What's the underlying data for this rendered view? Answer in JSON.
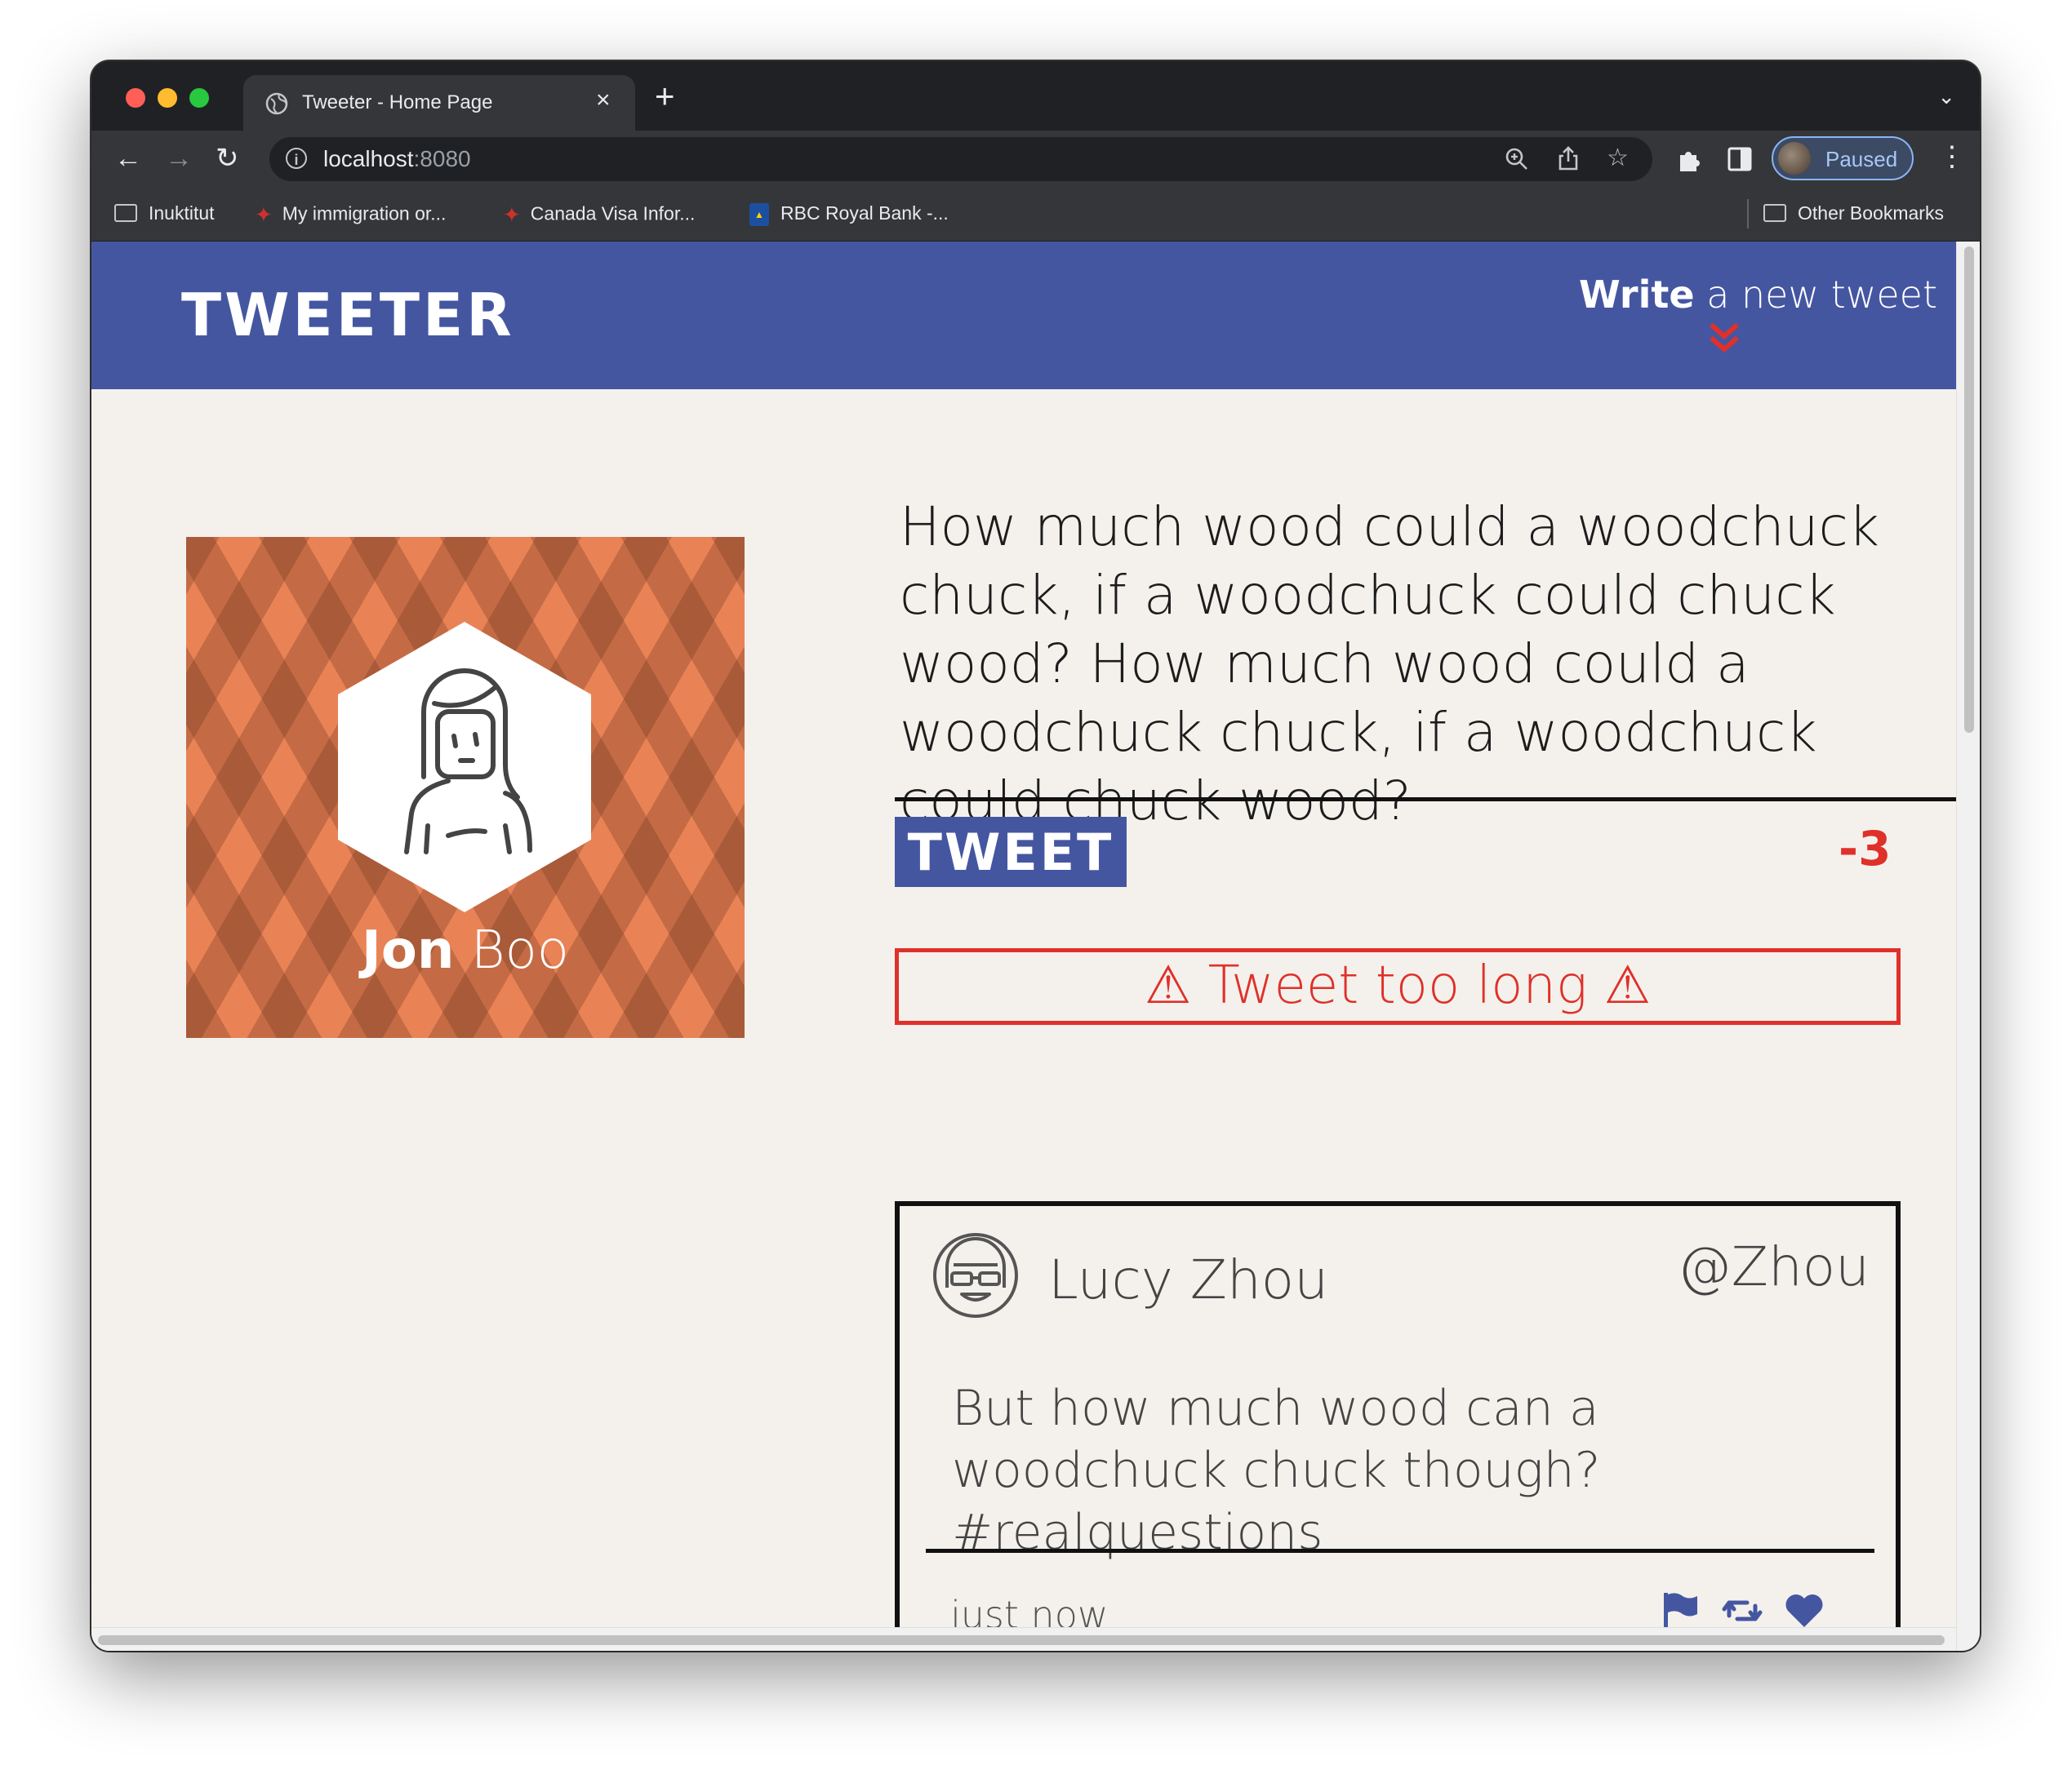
{
  "browser": {
    "tab_title": "Tweeter - Home Page",
    "url_host": "localhost",
    "url_port": ":8080",
    "profile_status": "Paused",
    "bookmarks": [
      "Inuktitut",
      "My immigration or...",
      "Canada Visa Infor...",
      "RBC Royal Bank -..."
    ],
    "other_bookmarks": "Other Bookmarks"
  },
  "header": {
    "logo": "TWEETER",
    "write_bold": "Write",
    "write_rest": " a new tweet"
  },
  "profile": {
    "first_name": "Jon",
    "last_name": " Boo"
  },
  "composer": {
    "text": "How much wood could a woodchuck chuck, if a woodchuck could chuck wood? How much wood could a woodchuck chuck, if a woodchuck could chuck wood?",
    "button_label": "TWEET",
    "counter": "-3",
    "error": "⚠ Tweet too long ⚠"
  },
  "tweet": {
    "name": "Lucy Zhou",
    "handle": "@Zhou",
    "content": "But how much wood can a woodchuck chuck though? #realquestions",
    "time": "just now",
    "actions": [
      "flag-icon",
      "retweet-icon",
      "heart-icon"
    ]
  },
  "colors": {
    "brand": "#4556a1",
    "error": "#e0302a",
    "page_bg": "#f4f1ec",
    "card_bg": "#e98356"
  }
}
